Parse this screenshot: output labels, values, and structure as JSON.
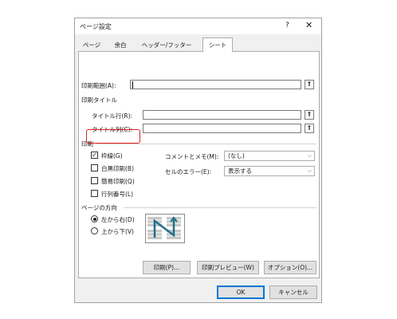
{
  "dialog": {
    "title": "ページ設定",
    "help": "?",
    "close": "✕"
  },
  "tabs": [
    "ページ",
    "余白",
    "ヘッダー/フッター",
    "シート"
  ],
  "active_tab": "シート",
  "print_area": {
    "label": "印刷範囲(A):",
    "value": ""
  },
  "print_titles": {
    "group": "印刷タイトル",
    "rows_label": "タイトル行(R):",
    "cols_label": "タイトル列(C):"
  },
  "print": {
    "group": "印刷",
    "gridlines": {
      "label": "枠線(G)",
      "checked": true
    },
    "bw": {
      "label": "白黒印刷(B)",
      "checked": false
    },
    "draft": {
      "label": "簡易印刷(Q)",
      "checked": false
    },
    "headings": {
      "label": "行列番号(L)",
      "checked": false
    },
    "comments_label": "コメントとメモ(M):",
    "comments_value": "(なし)",
    "errors_label": "セルのエラー(E):",
    "errors_value": "表示する"
  },
  "order": {
    "group": "ページの方向",
    "ltr": {
      "label": "左から右(D)",
      "selected": true
    },
    "ttb": {
      "label": "上から下(V)",
      "selected": false
    }
  },
  "buttons": {
    "print": "印刷(P)...",
    "preview": "印刷プレビュー(W)",
    "options": "オプション(O)...",
    "ok": "OK",
    "cancel": "キャンセル"
  },
  "icons": {
    "collapse": "collapse-dialog-icon",
    "dropdown": "chevron-down-icon"
  },
  "colors": {
    "highlight": "#e02020",
    "accent": "#0078d7"
  }
}
